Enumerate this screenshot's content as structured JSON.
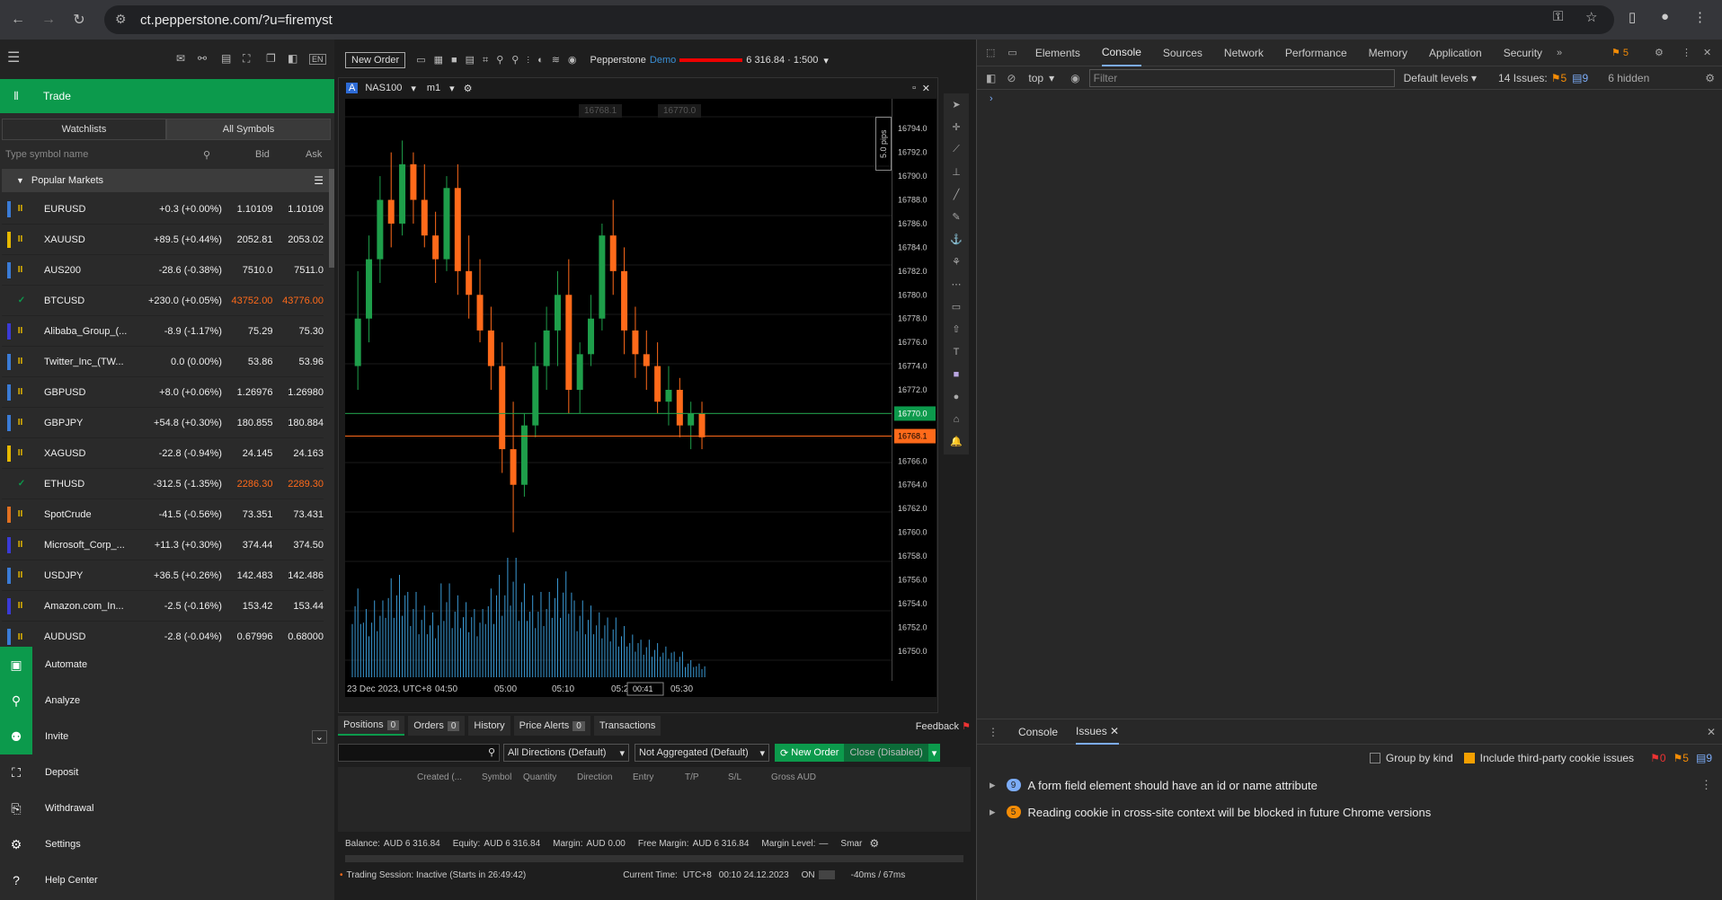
{
  "browser": {
    "url": "ct.pepperstone.com/?u=firemyst"
  },
  "toolbar": {
    "new_order": "New Order",
    "brand": "Pepperstone",
    "demo": "Demo",
    "balance_text": "6 316.84 · 1:500"
  },
  "left": {
    "trade": "Trade",
    "tabs": [
      "Watchlists",
      "All Symbols"
    ],
    "search_placeholder": "Type symbol name",
    "bid": "Bid",
    "ask": "Ask",
    "popular": "Popular Markets",
    "rows": [
      {
        "name": "EURUSD",
        "change": "+0.3 (+0.00%)",
        "bid": "1.10109",
        "ask": "1.10109",
        "mark": "#3a7bd5",
        "icon": "pause",
        "colored": false
      },
      {
        "name": "XAUUSD",
        "change": "+89.5 (+0.44%)",
        "bid": "2052.81",
        "ask": "2053.02",
        "mark": "#e6b800",
        "icon": "pause",
        "colored": false
      },
      {
        "name": "AUS200",
        "change": "-28.6 (-0.38%)",
        "bid": "7510.0",
        "ask": "7511.0",
        "mark": "#3a7bd5",
        "icon": "pause",
        "colored": false
      },
      {
        "name": "BTCUSD",
        "change": "+230.0 (+0.05%)",
        "bid": "43752.00",
        "ask": "43776.00",
        "mark": "#2a2a2a",
        "icon": "check",
        "colored": true
      },
      {
        "name": "Alibaba_Group_(...",
        "change": "-8.9 (-1.17%)",
        "bid": "75.29",
        "ask": "75.30",
        "mark": "#3a3ad5",
        "icon": "pause",
        "colored": false
      },
      {
        "name": "Twitter_Inc_(TW...",
        "change": "0.0 (0.00%)",
        "bid": "53.86",
        "ask": "53.96",
        "mark": "#3a7bd5",
        "icon": "pause",
        "colored": false
      },
      {
        "name": "GBPUSD",
        "change": "+8.0 (+0.06%)",
        "bid": "1.26976",
        "ask": "1.26980",
        "mark": "#3a7bd5",
        "icon": "pause",
        "colored": false
      },
      {
        "name": "GBPJPY",
        "change": "+54.8 (+0.30%)",
        "bid": "180.855",
        "ask": "180.884",
        "mark": "#3a7bd5",
        "icon": "pause",
        "colored": false
      },
      {
        "name": "XAGUSD",
        "change": "-22.8 (-0.94%)",
        "bid": "24.145",
        "ask": "24.163",
        "mark": "#e6b800",
        "icon": "pause",
        "colored": false
      },
      {
        "name": "ETHUSD",
        "change": "-312.5 (-1.35%)",
        "bid": "2286.30",
        "ask": "2289.30",
        "mark": "#2a2a2a",
        "icon": "check",
        "colored": true
      },
      {
        "name": "SpotCrude",
        "change": "-41.5 (-0.56%)",
        "bid": "73.351",
        "ask": "73.431",
        "mark": "#e07020",
        "icon": "pause",
        "colored": false
      },
      {
        "name": "Microsoft_Corp_...",
        "change": "+11.3 (+0.30%)",
        "bid": "374.44",
        "ask": "374.50",
        "mark": "#3a3ad5",
        "icon": "pause",
        "colored": false
      },
      {
        "name": "USDJPY",
        "change": "+36.5 (+0.26%)",
        "bid": "142.483",
        "ask": "142.486",
        "mark": "#3a7bd5",
        "icon": "pause",
        "colored": false
      },
      {
        "name": "Amazon.com_In...",
        "change": "-2.5 (-0.16%)",
        "bid": "153.42",
        "ask": "153.44",
        "mark": "#3a3ad5",
        "icon": "pause",
        "colored": false
      },
      {
        "name": "AUDUSD",
        "change": "-2.8 (-0.04%)",
        "bid": "0.67996",
        "ask": "0.68000",
        "mark": "#3a7bd5",
        "icon": "pause",
        "colored": false
      }
    ],
    "nav": [
      "Automate",
      "Analyze",
      "Invite",
      "Deposit",
      "Withdrawal",
      "Settings",
      "Help Center"
    ]
  },
  "chart": {
    "symbol": "NAS100",
    "timeframe": "m1",
    "price_left": "16768.1",
    "price_right": "16770.0",
    "pips": "5.0 pips",
    "y_ticks": [
      "16794.0",
      "16792.0",
      "16790.0",
      "16788.0",
      "16786.0",
      "16784.0",
      "16782.0",
      "16780.0",
      "16778.0",
      "16776.0",
      "16774.0",
      "16772.0",
      "16770.0",
      "16768.1",
      "16766.0",
      "16764.0",
      "16762.0",
      "16760.0",
      "16758.0",
      "16756.0",
      "16754.0",
      "16752.0",
      "16750.0"
    ],
    "ask_label": "16770.0",
    "bid_label": "16768.1",
    "x_labels": [
      "23 Dec 2023, UTC+8",
      "04:50",
      "05:00",
      "05:10",
      "05:20",
      "05:30"
    ],
    "countdown": "00:41"
  },
  "chart_data": {
    "type": "candlestick",
    "ylim": [
      16749,
      16795
    ],
    "ask": 16770.0,
    "bid": 16768.1,
    "ohlc": [
      [
        16774,
        16782,
        16772,
        16778
      ],
      [
        16778,
        16785,
        16776,
        16783
      ],
      [
        16783,
        16790,
        16781,
        16788
      ],
      [
        16788,
        16792,
        16784,
        16786
      ],
      [
        16786,
        16793,
        16785,
        16791
      ],
      [
        16791,
        16792,
        16786,
        16788
      ],
      [
        16788,
        16791,
        16784,
        16785
      ],
      [
        16785,
        16787,
        16781,
        16783
      ],
      [
        16783,
        16790,
        16782,
        16789
      ],
      [
        16789,
        16791,
        16780,
        16782
      ],
      [
        16782,
        16785,
        16778,
        16780
      ],
      [
        16780,
        16783,
        16776,
        16777
      ],
      [
        16777,
        16779,
        16772,
        16774
      ],
      [
        16774,
        16776,
        16765,
        16767
      ],
      [
        16767,
        16771,
        16760,
        16764
      ],
      [
        16764,
        16770,
        16763,
        16769
      ],
      [
        16769,
        16776,
        16768,
        16774
      ],
      [
        16774,
        16779,
        16772,
        16777
      ],
      [
        16777,
        16782,
        16774,
        16780
      ],
      [
        16780,
        16783,
        16770,
        16772
      ],
      [
        16772,
        16776,
        16770,
        16775
      ],
      [
        16775,
        16780,
        16774,
        16778
      ],
      [
        16778,
        16786,
        16777,
        16785
      ],
      [
        16785,
        16788,
        16780,
        16782
      ],
      [
        16782,
        16784,
        16775,
        16777
      ],
      [
        16777,
        16779,
        16773,
        16775
      ],
      [
        16775,
        16777,
        16772,
        16774
      ],
      [
        16774,
        16776,
        16770,
        16771
      ],
      [
        16771,
        16774,
        16769,
        16772
      ],
      [
        16772,
        16773,
        16768,
        16769
      ],
      [
        16769,
        16771,
        16767,
        16770
      ],
      [
        16770,
        16771,
        16767,
        16768
      ]
    ],
    "volume": [
      52,
      40,
      45,
      58,
      60,
      50,
      42,
      38,
      55,
      48,
      44,
      40,
      52,
      60,
      70,
      55,
      48,
      50,
      58,
      62,
      45,
      42,
      38,
      35,
      30,
      25,
      22,
      20,
      18,
      15,
      10,
      8
    ]
  },
  "bottom": {
    "tabs": [
      {
        "label": "Positions",
        "count": "0"
      },
      {
        "label": "Orders",
        "count": "0"
      },
      {
        "label": "History",
        "count": ""
      },
      {
        "label": "Price Alerts",
        "count": "0"
      },
      {
        "label": "Transactions",
        "count": ""
      }
    ],
    "feedback": "Feedback",
    "dir": "All Directions (Default)",
    "agg": "Not Aggregated (Default)",
    "new_order": "New Order",
    "close": "Close (Disabled)",
    "cols": [
      "Created (...",
      "Symbol",
      "Quantity",
      "Direction",
      "Entry",
      "T/P",
      "S/L",
      "Gross AUD"
    ],
    "balance": "Balance:",
    "balance_v": "AUD 6 316.84",
    "equity": "Equity:",
    "equity_v": "AUD 6 316.84",
    "margin": "Margin:",
    "margin_v": "AUD 0.00",
    "free": "Free Margin:",
    "free_v": "AUD 6 316.84",
    "level": "Margin Level:",
    "level_v": "—",
    "smart": "Smar",
    "session": "Trading Session: Inactive (Starts in 26:49:42)",
    "time_label": "Current Time:",
    "tz": "UTC+8",
    "time": "00:10 24.12.2023",
    "on": "ON",
    "latency": "-40ms / 67ms"
  },
  "dev": {
    "tabs": [
      "Elements",
      "Console",
      "Sources",
      "Network",
      "Performance",
      "Memory",
      "Application",
      "Security"
    ],
    "issues_warn": "5",
    "context": "top",
    "filter_placeholder": "Filter",
    "levels": "Default levels",
    "issues": "14 Issues:",
    "i_warn": "5",
    "i_info": "9",
    "hidden": "6 hidden",
    "drawer_tabs": [
      "Console",
      "Issues"
    ],
    "group": "Group by kind",
    "third": "Include third-party cookie issues",
    "c0": "0",
    "c5": "5",
    "c9": "9",
    "items": [
      {
        "count": "9",
        "text": "A form field element should have an id or name attribute",
        "kind": "info"
      },
      {
        "count": "5",
        "text": "Reading cookie in cross-site context will be blocked in future Chrome versions",
        "kind": "warn"
      }
    ]
  }
}
